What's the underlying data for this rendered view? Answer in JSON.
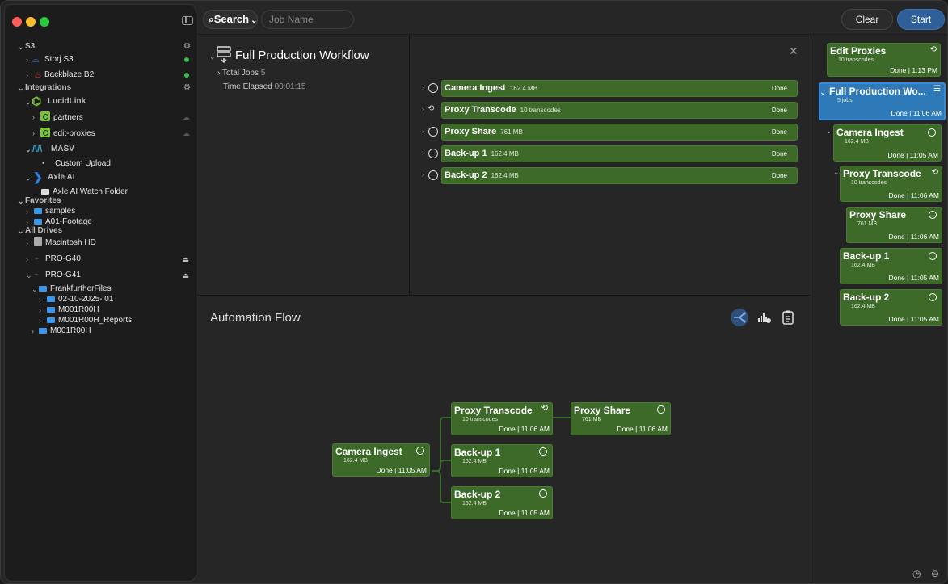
{
  "window": {
    "colors": {
      "close": "#ff5f57",
      "minimize": "#febc2e",
      "zoom": "#28c840",
      "accent": "#2f5f98",
      "job_green": "#3d6a29"
    }
  },
  "toolbar": {
    "search_label": "Search",
    "search_chevron": "⌄",
    "job_placeholder": "Job Name",
    "clear_label": "Clear",
    "start_label": "Start"
  },
  "sidebar": {
    "s3": {
      "label": "S3",
      "items": [
        {
          "label": "Storj S3"
        },
        {
          "label": "Backblaze B2"
        }
      ]
    },
    "integrations": {
      "label": "Integrations",
      "lucidlink": {
        "label": "LucidLink",
        "items": [
          {
            "label": "partners"
          },
          {
            "label": "edit-proxies"
          }
        ]
      },
      "masv": {
        "label": "MASV",
        "items": [
          {
            "label": "Custom Upload"
          }
        ]
      },
      "axle": {
        "label": "Axle AI",
        "items": [
          {
            "label": "Axle AI Watch Folder"
          }
        ]
      }
    },
    "favorites": {
      "label": "Favorites",
      "items": [
        {
          "label": "samples"
        },
        {
          "label": "A01-Footage"
        }
      ]
    },
    "drives": {
      "label": "All Drives",
      "items": [
        {
          "label": "Macintosh HD"
        },
        {
          "label": "PRO-G40"
        },
        {
          "label": "PRO-G41"
        }
      ],
      "pro_g41_children": [
        {
          "label": "FrankfurtherFiles"
        },
        {
          "label": "02-10-2025- 01"
        },
        {
          "label": "M001R00H"
        },
        {
          "label": "M001R00H_Reports"
        },
        {
          "label": "M001R00H"
        }
      ]
    }
  },
  "workflow": {
    "title": "Full Production Workflow",
    "total_jobs_label": "Total Jobs",
    "total_jobs": "5",
    "elapsed_label": "Time Elapsed",
    "elapsed": "00:01:15"
  },
  "jobs": [
    {
      "name": "Camera Ingest",
      "size": "162.4 MB",
      "status": "Done",
      "icon": "circle-icon"
    },
    {
      "name": "Proxy Transcode",
      "size": "10 transcodes",
      "status": "Done",
      "icon": "transcode-icon"
    },
    {
      "name": "Proxy Share",
      "size": "761 MB",
      "status": "Done",
      "icon": "circle-icon"
    },
    {
      "name": "Back-up 1",
      "size": "162.4 MB",
      "status": "Done",
      "icon": "circle-icon"
    },
    {
      "name": "Back-up 2",
      "size": "162.4 MB",
      "status": "Done",
      "icon": "circle-icon"
    }
  ],
  "automation": {
    "title": "Automation Flow",
    "nodes": [
      {
        "name": "Camera Ingest",
        "sub": "162.4 MB",
        "done": "Done | 11:05 AM"
      },
      {
        "name": "Proxy Transcode",
        "sub": "10 transcodes",
        "done": "Done | 11:06 AM"
      },
      {
        "name": "Proxy Share",
        "sub": "761 MB",
        "done": "Done | 11:06 AM"
      },
      {
        "name": "Back-up 1",
        "sub": "162.4 MB",
        "done": "Done | 11:05 AM"
      },
      {
        "name": "Back-up 2",
        "sub": "162.4 MB",
        "done": "Done | 11:05 AM"
      }
    ]
  },
  "history": [
    {
      "name": "Edit Proxies",
      "sub": "10 transcodes",
      "done": "Done | 1:13 PM"
    },
    {
      "name": "Full Production Wo...",
      "sub": "5 jobs",
      "done": "Done | 11:06 AM"
    },
    {
      "name": "Camera Ingest",
      "sub": "162.4 MB",
      "done": "Done | 11:05 AM"
    },
    {
      "name": "Proxy Transcode",
      "sub": "10 transcodes",
      "done": "Done | 11:06 AM"
    },
    {
      "name": "Proxy Share",
      "sub": "761 MB",
      "done": "Done | 11:06 AM"
    },
    {
      "name": "Back-up 1",
      "sub": "162.4 MB",
      "done": "Done | 11:05 AM"
    },
    {
      "name": "Back-up 2",
      "sub": "162.4 MB",
      "done": "Done | 11:05 AM"
    }
  ]
}
